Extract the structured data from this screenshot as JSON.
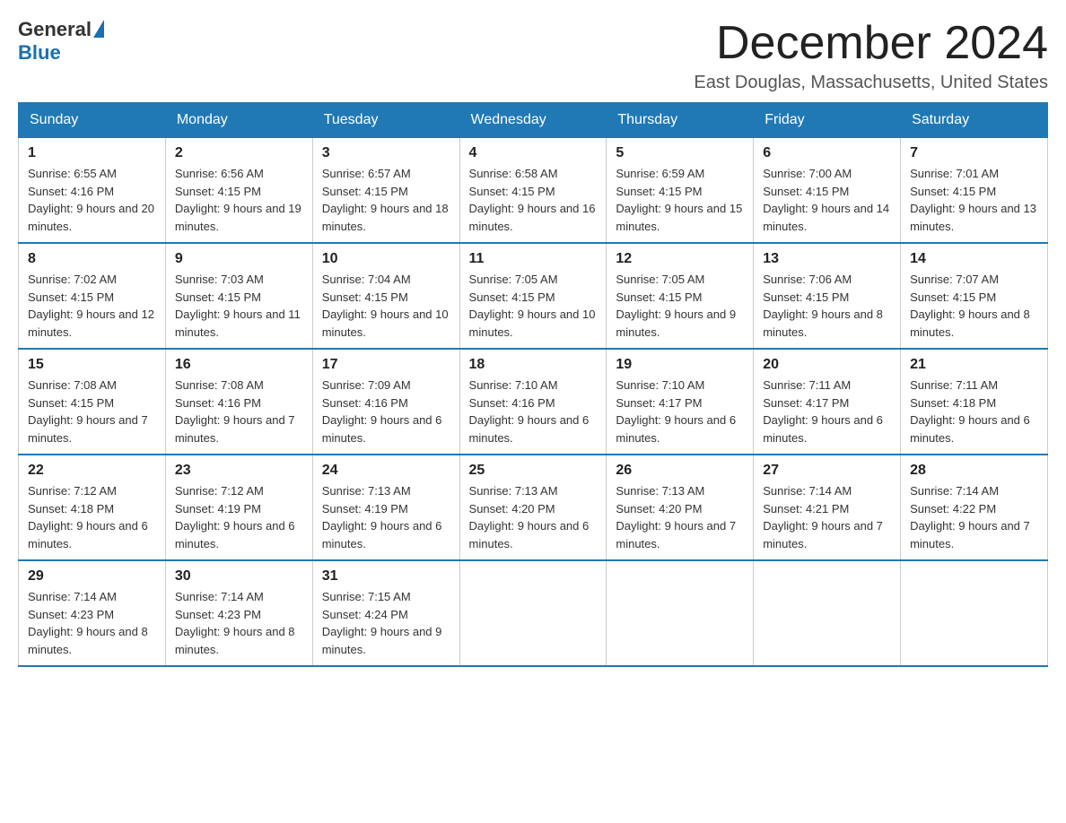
{
  "header": {
    "logo_general": "General",
    "logo_blue": "Blue",
    "month_title": "December 2024",
    "location": "East Douglas, Massachusetts, United States"
  },
  "days_of_week": [
    "Sunday",
    "Monday",
    "Tuesday",
    "Wednesday",
    "Thursday",
    "Friday",
    "Saturday"
  ],
  "weeks": [
    [
      {
        "num": "1",
        "sunrise": "6:55 AM",
        "sunset": "4:16 PM",
        "daylight": "9 hours and 20 minutes."
      },
      {
        "num": "2",
        "sunrise": "6:56 AM",
        "sunset": "4:15 PM",
        "daylight": "9 hours and 19 minutes."
      },
      {
        "num": "3",
        "sunrise": "6:57 AM",
        "sunset": "4:15 PM",
        "daylight": "9 hours and 18 minutes."
      },
      {
        "num": "4",
        "sunrise": "6:58 AM",
        "sunset": "4:15 PM",
        "daylight": "9 hours and 16 minutes."
      },
      {
        "num": "5",
        "sunrise": "6:59 AM",
        "sunset": "4:15 PM",
        "daylight": "9 hours and 15 minutes."
      },
      {
        "num": "6",
        "sunrise": "7:00 AM",
        "sunset": "4:15 PM",
        "daylight": "9 hours and 14 minutes."
      },
      {
        "num": "7",
        "sunrise": "7:01 AM",
        "sunset": "4:15 PM",
        "daylight": "9 hours and 13 minutes."
      }
    ],
    [
      {
        "num": "8",
        "sunrise": "7:02 AM",
        "sunset": "4:15 PM",
        "daylight": "9 hours and 12 minutes."
      },
      {
        "num": "9",
        "sunrise": "7:03 AM",
        "sunset": "4:15 PM",
        "daylight": "9 hours and 11 minutes."
      },
      {
        "num": "10",
        "sunrise": "7:04 AM",
        "sunset": "4:15 PM",
        "daylight": "9 hours and 10 minutes."
      },
      {
        "num": "11",
        "sunrise": "7:05 AM",
        "sunset": "4:15 PM",
        "daylight": "9 hours and 10 minutes."
      },
      {
        "num": "12",
        "sunrise": "7:05 AM",
        "sunset": "4:15 PM",
        "daylight": "9 hours and 9 minutes."
      },
      {
        "num": "13",
        "sunrise": "7:06 AM",
        "sunset": "4:15 PM",
        "daylight": "9 hours and 8 minutes."
      },
      {
        "num": "14",
        "sunrise": "7:07 AM",
        "sunset": "4:15 PM",
        "daylight": "9 hours and 8 minutes."
      }
    ],
    [
      {
        "num": "15",
        "sunrise": "7:08 AM",
        "sunset": "4:15 PM",
        "daylight": "9 hours and 7 minutes."
      },
      {
        "num": "16",
        "sunrise": "7:08 AM",
        "sunset": "4:16 PM",
        "daylight": "9 hours and 7 minutes."
      },
      {
        "num": "17",
        "sunrise": "7:09 AM",
        "sunset": "4:16 PM",
        "daylight": "9 hours and 6 minutes."
      },
      {
        "num": "18",
        "sunrise": "7:10 AM",
        "sunset": "4:16 PM",
        "daylight": "9 hours and 6 minutes."
      },
      {
        "num": "19",
        "sunrise": "7:10 AM",
        "sunset": "4:17 PM",
        "daylight": "9 hours and 6 minutes."
      },
      {
        "num": "20",
        "sunrise": "7:11 AM",
        "sunset": "4:17 PM",
        "daylight": "9 hours and 6 minutes."
      },
      {
        "num": "21",
        "sunrise": "7:11 AM",
        "sunset": "4:18 PM",
        "daylight": "9 hours and 6 minutes."
      }
    ],
    [
      {
        "num": "22",
        "sunrise": "7:12 AM",
        "sunset": "4:18 PM",
        "daylight": "9 hours and 6 minutes."
      },
      {
        "num": "23",
        "sunrise": "7:12 AM",
        "sunset": "4:19 PM",
        "daylight": "9 hours and 6 minutes."
      },
      {
        "num": "24",
        "sunrise": "7:13 AM",
        "sunset": "4:19 PM",
        "daylight": "9 hours and 6 minutes."
      },
      {
        "num": "25",
        "sunrise": "7:13 AM",
        "sunset": "4:20 PM",
        "daylight": "9 hours and 6 minutes."
      },
      {
        "num": "26",
        "sunrise": "7:13 AM",
        "sunset": "4:20 PM",
        "daylight": "9 hours and 7 minutes."
      },
      {
        "num": "27",
        "sunrise": "7:14 AM",
        "sunset": "4:21 PM",
        "daylight": "9 hours and 7 minutes."
      },
      {
        "num": "28",
        "sunrise": "7:14 AM",
        "sunset": "4:22 PM",
        "daylight": "9 hours and 7 minutes."
      }
    ],
    [
      {
        "num": "29",
        "sunrise": "7:14 AM",
        "sunset": "4:23 PM",
        "daylight": "9 hours and 8 minutes."
      },
      {
        "num": "30",
        "sunrise": "7:14 AM",
        "sunset": "4:23 PM",
        "daylight": "9 hours and 8 minutes."
      },
      {
        "num": "31",
        "sunrise": "7:15 AM",
        "sunset": "4:24 PM",
        "daylight": "9 hours and 9 minutes."
      },
      null,
      null,
      null,
      null
    ]
  ]
}
